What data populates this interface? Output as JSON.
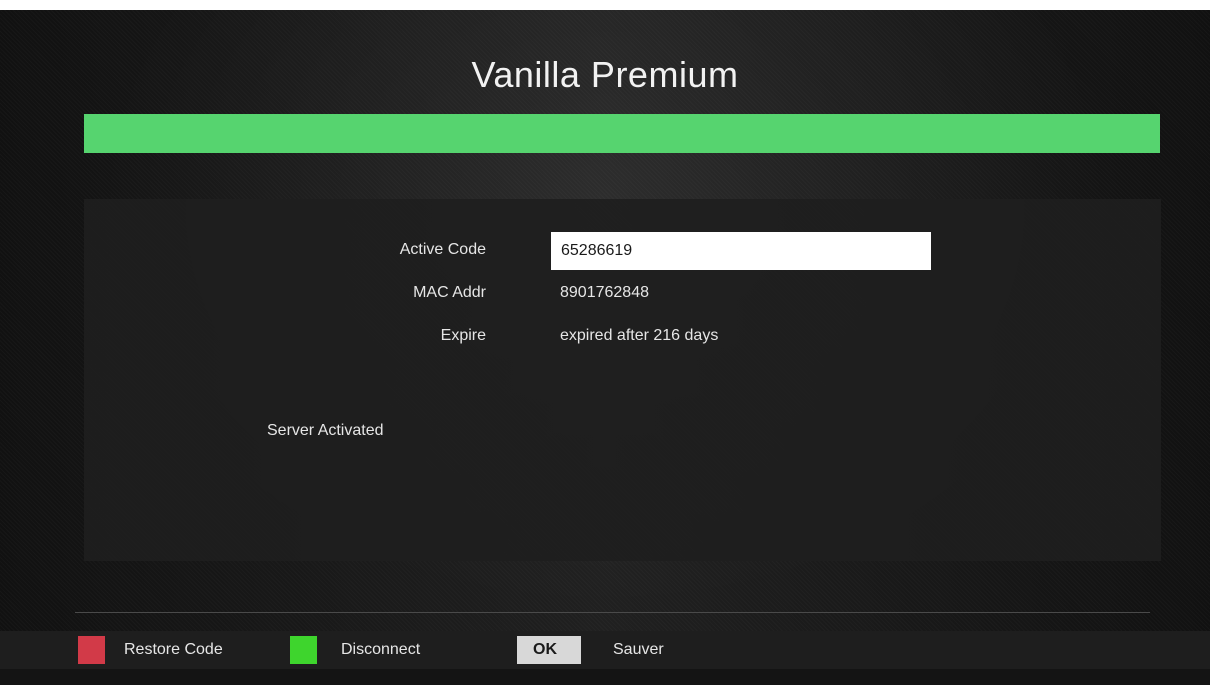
{
  "title": "Vanilla Premium",
  "progress": {
    "fraction": 1.0,
    "color": "#56d46f"
  },
  "form": {
    "active_code": {
      "label": "Active Code",
      "value": "65286619"
    },
    "mac_addr": {
      "label": "MAC Addr",
      "value": "8901762848"
    },
    "expire": {
      "label": "Expire",
      "value": "expired after 216 days"
    }
  },
  "status": "Server Activated",
  "footer": {
    "restore": {
      "label": "Restore Code",
      "color": "#d23a48"
    },
    "disconnect": {
      "label": "Disconnect",
      "color": "#3ed52d"
    },
    "ok": {
      "key": "OK",
      "label": "Sauver"
    }
  }
}
